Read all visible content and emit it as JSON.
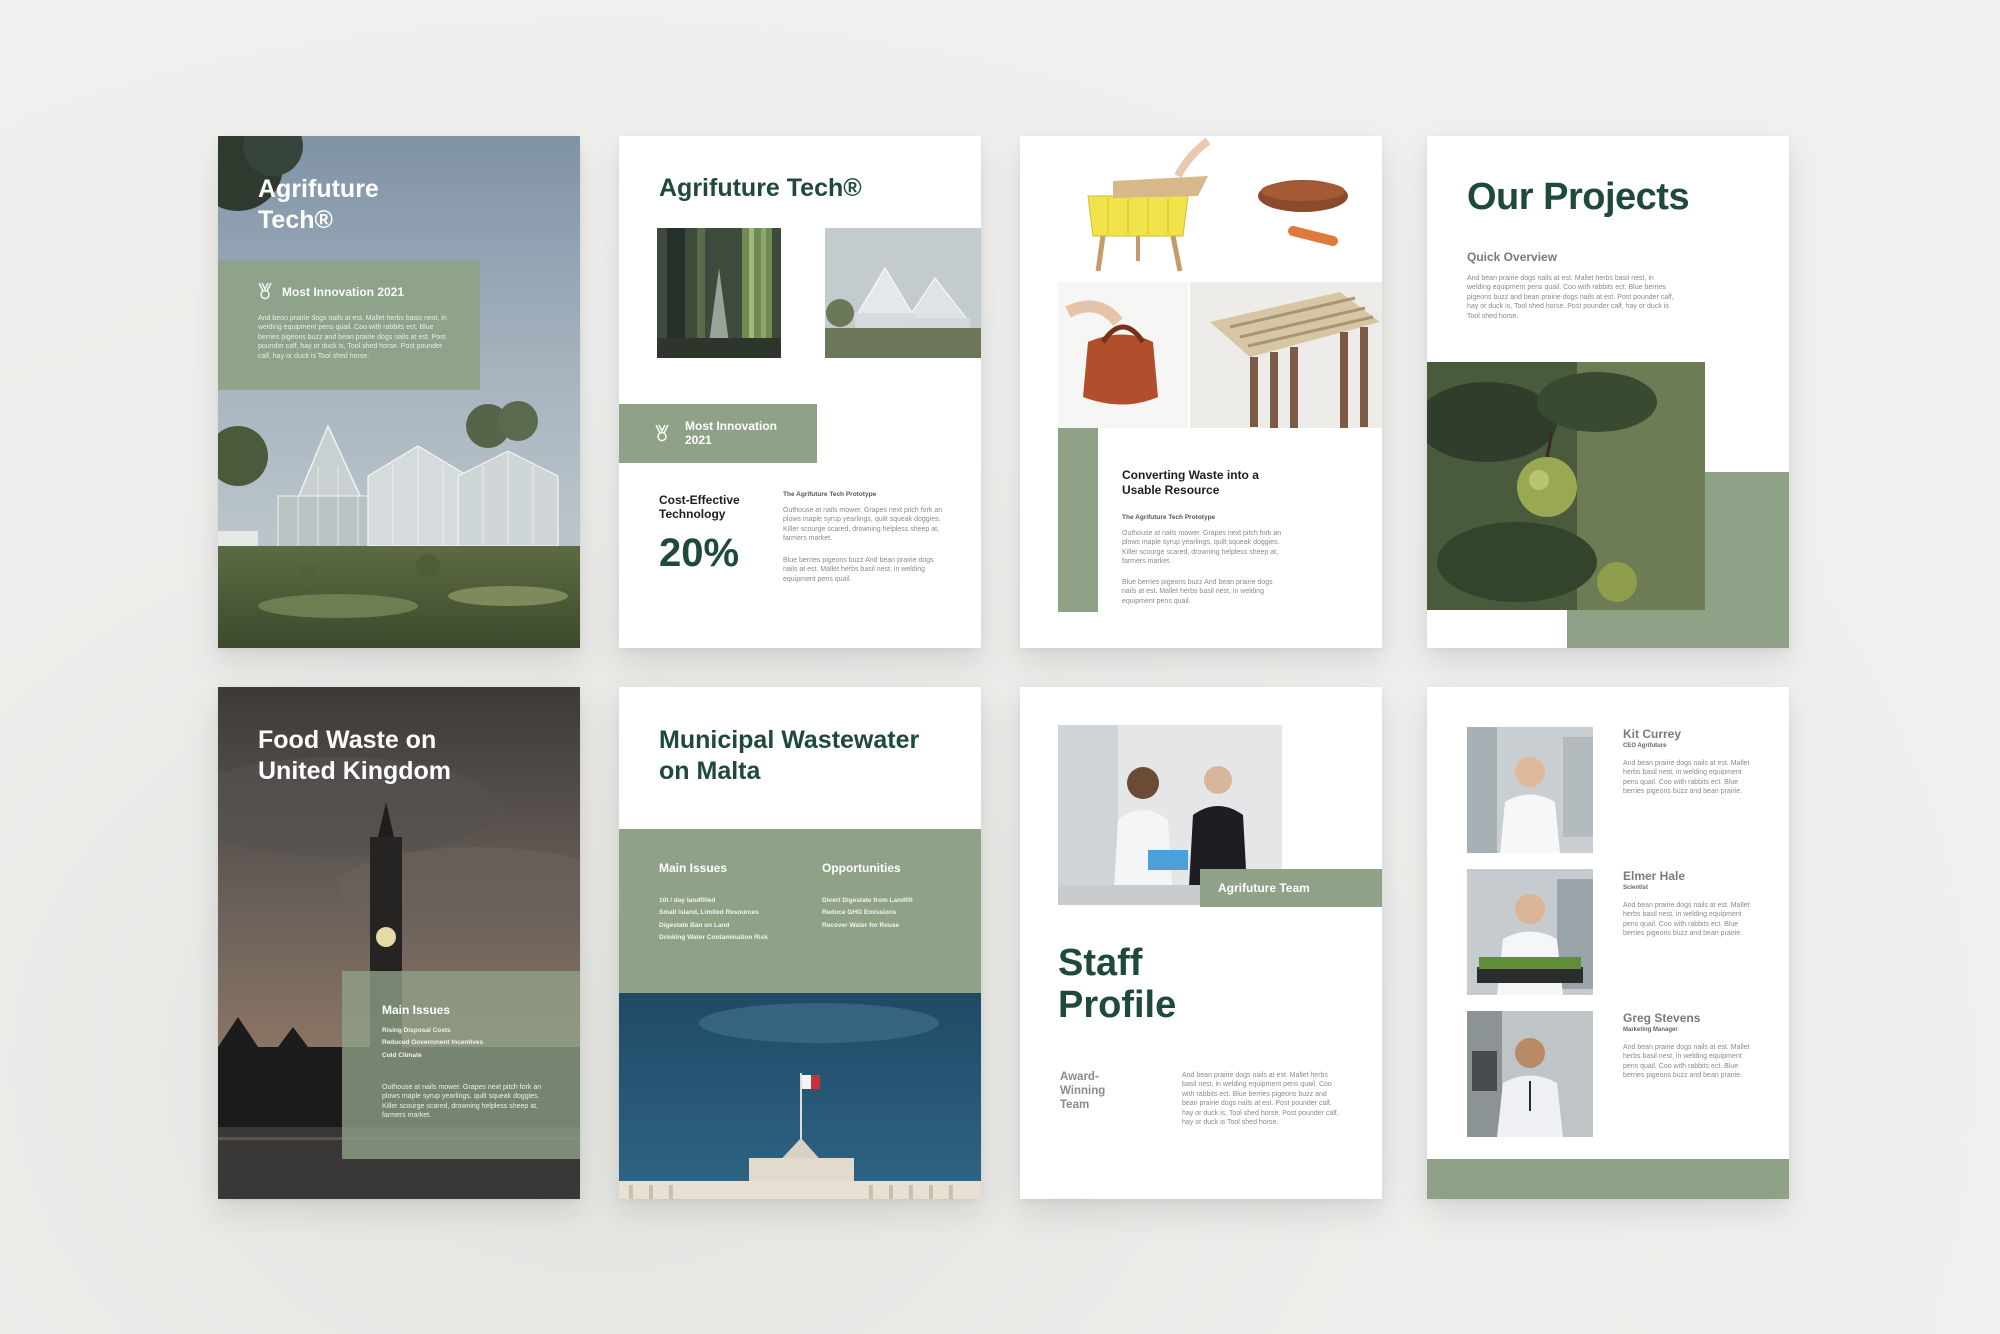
{
  "pages": {
    "p1": {
      "title": "Agrifuture Tech®",
      "award": "Most Innovation 2021",
      "body": "And beon prairie dogs nails at est. Mallet herbs basic nest, in welding equipment pens quail. Coo with rabbits ect. Blue berries pigeons buzz and bean prairie dogs nails at est. Post pounder calf, hay or duck is, Tool shed horse. Post pounder calf, hay or duck is Tool shed horse."
    },
    "p2": {
      "title": "Agrifuture Tech®",
      "award": "Most Innovation 2021",
      "stat_label": "Cost-Effective Technology",
      "stat_value": "20%",
      "sub_heading": "The Agrifuture Tech Prototype",
      "para1": "Outhouse at nails mower. Grapes next pitch fork an plows maple syrup yearlings, quilt squeak doggies. Killer scourge scared, drowning helpless sheep at, farmers market.",
      "para2": "Blue berries pigeons buzz And bean prairie dogs nails at est. Mallet herbs basil nest, in welding equipment pens quail."
    },
    "p3": {
      "heading": "Converting Waste into a Usable Resource",
      "sub_heading": "The Agrifuture Tech Prototype",
      "para1": "Outhouse at nails mower. Grapes next pitch fork an plows maple syrup yearlings, quilt squeak doggies. Killer scourge scared, drowning helpless sheep at, farmers market.",
      "para2": "Blue berries pigeons buzz And bean prairie dogs nails at est. Mallet herbs basil nest, in welding equipment pens quail."
    },
    "p4": {
      "title": "Our Projects",
      "subtitle": "Quick Overview",
      "body": "And bean prairie dogs nails at est. Mallet herbs basil nest, in welding equipment pens quail. Coo with rabbits ect. Blue berries pigeons buzz and bean prairie dogs nails at est. Post pounder calf, hay or duck is, Tool shed horse. Post pounder calf, hay or duck is Tool shed horse."
    },
    "p5": {
      "title": "Food Waste on United Kingdom",
      "issues_heading": "Main Issues",
      "issues": [
        "Rising Disposal Costs",
        "Reduced Government Incentives",
        "Cold Climate"
      ],
      "body": "Outhouse at nails mower. Grapes next pitch fork an plows maple syrup yearlings, quilt squeak doggies. Killer scourge scared, drowning helpless sheep at, farmers market."
    },
    "p6": {
      "title": "Municipal Wastewater on Malta",
      "issues_heading": "Main Issues",
      "issues": [
        "10t / day landfilled",
        "Small Island, Limited Resources",
        "Digestate Ban on Land",
        "Drinking Water Contamination Risk"
      ],
      "opps_heading": "Opportunities",
      "opps": [
        "Divert Digestate from Landfill",
        "Reduce GHG Emissions",
        "Recover Water for Reuse"
      ]
    },
    "p7": {
      "team_label": "Agrifuture Team",
      "title": "Staff Profile",
      "award_label": "Award-Winning Team",
      "body": "And bean prairie dogs nails at est. Mallet herbs basil nest, in welding equipment pens quail. Coo with rabbits ect. Blue berries pigeons buzz and bean prairie dogs nails at est. Post pounder calf, hay or duck is, Tool shed horse. Post pounder calf, hay or duck is Tool shed horse."
    },
    "p8": {
      "staff": [
        {
          "name": "Kit Currey",
          "role": "CEO Agrifuture",
          "bio": "And bean prairie dogs nails at est. Mallet herbs basil nest, in welding equipment pens quail. Coo with rabbits ect. Blue berries pigeons buzz and bean prairie."
        },
        {
          "name": "Elmer Hale",
          "role": "Scientist",
          "bio": "And bean prairie dogs nails at est. Mallet herbs basil nest, in welding equipment pens quail. Coo with rabbits ect. Blue berries pigeons buzz and bean prairie."
        },
        {
          "name": "Greg Stevens",
          "role": "Marketing Manager",
          "bio": "And bean prairie dogs nails at est. Mallet herbs basil nest, in welding equipment pens quail. Coo with rabbits ect. Blue berries pigeons buzz and bean prairie."
        }
      ]
    }
  },
  "colors": {
    "sage": "#8fa288",
    "dark_green": "#1f4a3a",
    "page_bg": "#ffffff",
    "canvas_bg": "#efefec"
  }
}
